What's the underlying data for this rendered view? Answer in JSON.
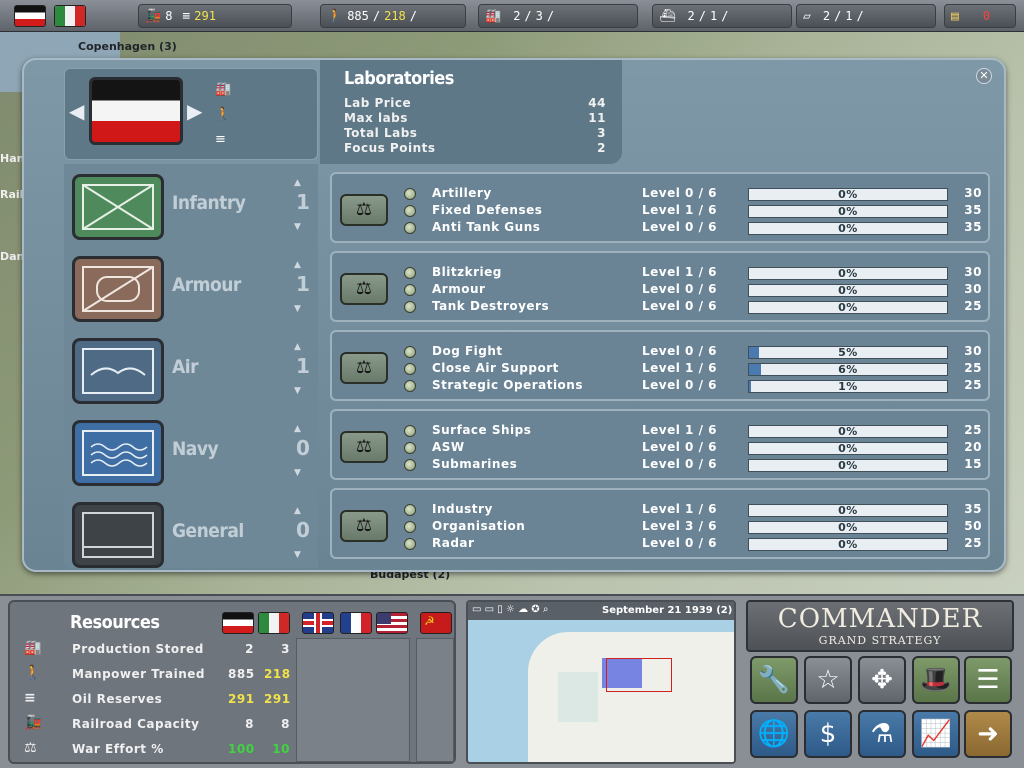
{
  "topbar": {
    "rail": "8",
    "oil": "291",
    "manpower_a": "885",
    "manpower_b": "218",
    "industry_a": "2",
    "industry_b": "3",
    "ships_a": "2",
    "ships_b": "1",
    "subs_a": "2",
    "subs_b": "1",
    "gold": "0"
  },
  "map": {
    "city1": "Copenhagen (3)",
    "city2": "Budapest (2)",
    "edge1": "Han",
    "edge2": "Rail",
    "edge3": "Dani"
  },
  "faction": {
    "production": "2",
    "manpower": "885",
    "oil": "291"
  },
  "labs": {
    "title": "Laboratories",
    "rows": [
      {
        "label": "Lab Price",
        "value": "44"
      },
      {
        "label": "Max labs",
        "value": "11"
      },
      {
        "label": "Total Labs",
        "value": "3"
      },
      {
        "label": "Focus Points",
        "value": "2"
      }
    ]
  },
  "categories": [
    {
      "name": "Infantry",
      "count": "1"
    },
    {
      "name": "Armour",
      "count": "1"
    },
    {
      "name": "Air",
      "count": "1"
    },
    {
      "name": "Navy",
      "count": "0"
    },
    {
      "name": "General",
      "count": "0"
    }
  ],
  "tech_groups": [
    {
      "techs": [
        {
          "name": "Artillery",
          "level": "Level 0 /  6",
          "pct": "0%",
          "progress": 0,
          "cost": "30"
        },
        {
          "name": "Fixed Defenses",
          "level": "Level 1 /  6",
          "pct": "0%",
          "progress": 0,
          "cost": "35"
        },
        {
          "name": "Anti Tank Guns",
          "level": "Level 0 /  6",
          "pct": "0%",
          "progress": 0,
          "cost": "35"
        }
      ]
    },
    {
      "techs": [
        {
          "name": "Blitzkrieg",
          "level": "Level 1 /  6",
          "pct": "0%",
          "progress": 0,
          "cost": "30"
        },
        {
          "name": "Armour",
          "level": "Level 0 /  6",
          "pct": "0%",
          "progress": 0,
          "cost": "30"
        },
        {
          "name": "Tank Destroyers",
          "level": "Level 0 /  6",
          "pct": "0%",
          "progress": 0,
          "cost": "25"
        }
      ]
    },
    {
      "techs": [
        {
          "name": "Dog Fight",
          "level": "Level 0 /  6",
          "pct": "5%",
          "progress": 5,
          "cost": "30"
        },
        {
          "name": "Close Air Support",
          "level": "Level 1 /  6",
          "pct": "6%",
          "progress": 6,
          "cost": "25"
        },
        {
          "name": "Strategic Operations",
          "level": "Level 0 /  6",
          "pct": "1%",
          "progress": 1,
          "cost": "25"
        }
      ]
    },
    {
      "techs": [
        {
          "name": "Surface Ships",
          "level": "Level 1 /  6",
          "pct": "0%",
          "progress": 0,
          "cost": "25"
        },
        {
          "name": "ASW",
          "level": "Level 0 /  6",
          "pct": "0%",
          "progress": 0,
          "cost": "20"
        },
        {
          "name": "Submarines",
          "level": "Level 0 /  6",
          "pct": "0%",
          "progress": 0,
          "cost": "15"
        }
      ]
    },
    {
      "techs": [
        {
          "name": "Industry",
          "level": "Level 1 /  6",
          "pct": "0%",
          "progress": 0,
          "cost": "35"
        },
        {
          "name": "Organisation",
          "level": "Level 3 /  6",
          "pct": "0%",
          "progress": 0,
          "cost": "50"
        },
        {
          "name": "Radar",
          "level": "Level 0 /  6",
          "pct": "0%",
          "progress": 0,
          "cost": "25"
        }
      ]
    }
  ],
  "resources": {
    "title": "Resources",
    "rows": [
      {
        "label": "Production Stored",
        "v1": "2",
        "v2": "3"
      },
      {
        "label": "Manpower Trained",
        "v1": "885",
        "v2": "218"
      },
      {
        "label": "Oil Reserves",
        "v1": "291",
        "v2": "291"
      },
      {
        "label": "Railroad Capacity",
        "v1": "8",
        "v2": "8"
      },
      {
        "label": "War Effort %",
        "v1": "100",
        "v2": "10"
      }
    ]
  },
  "minimap": {
    "date": "September 21 1939 (2)"
  },
  "commander": {
    "title": "COMMANDER",
    "subtitle": "GRAND STRATEGY"
  }
}
